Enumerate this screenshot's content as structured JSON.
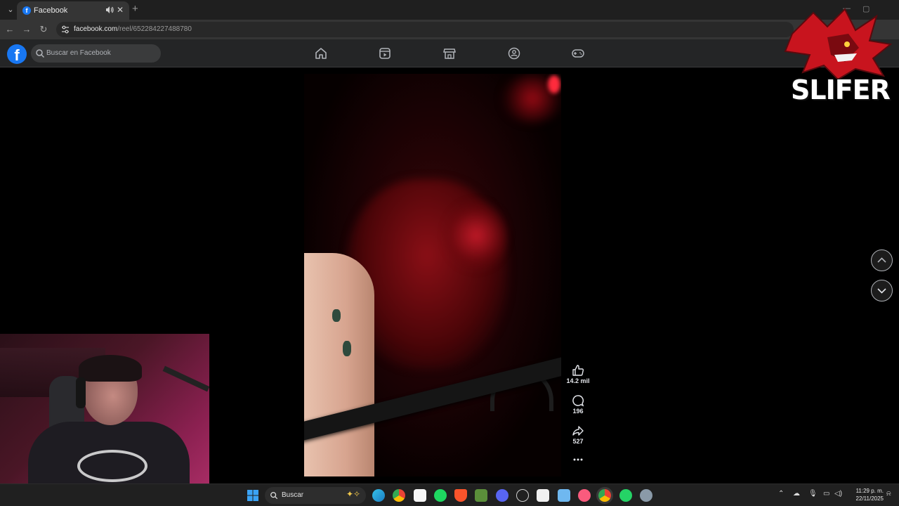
{
  "browser": {
    "tab": {
      "title": "Facebook",
      "favicon": "facebook-f-icon"
    },
    "address": {
      "domain": "facebook.com",
      "path": "/reel/652284227488780"
    }
  },
  "facebook": {
    "search_placeholder": "Buscar en Facebook",
    "nav_icons": [
      "home-icon",
      "video-icon",
      "marketplace-icon",
      "groups-icon",
      "gaming-icon"
    ],
    "brand_color": "#1877f2"
  },
  "reel": {
    "likes": "14.2 mil",
    "comments": "196",
    "shares": "527"
  },
  "overlay": {
    "logo_text": "SLIFER"
  },
  "taskbar": {
    "search_placeholder": "Buscar",
    "time": "11:29 p. m.",
    "date": "22/11/2025"
  }
}
